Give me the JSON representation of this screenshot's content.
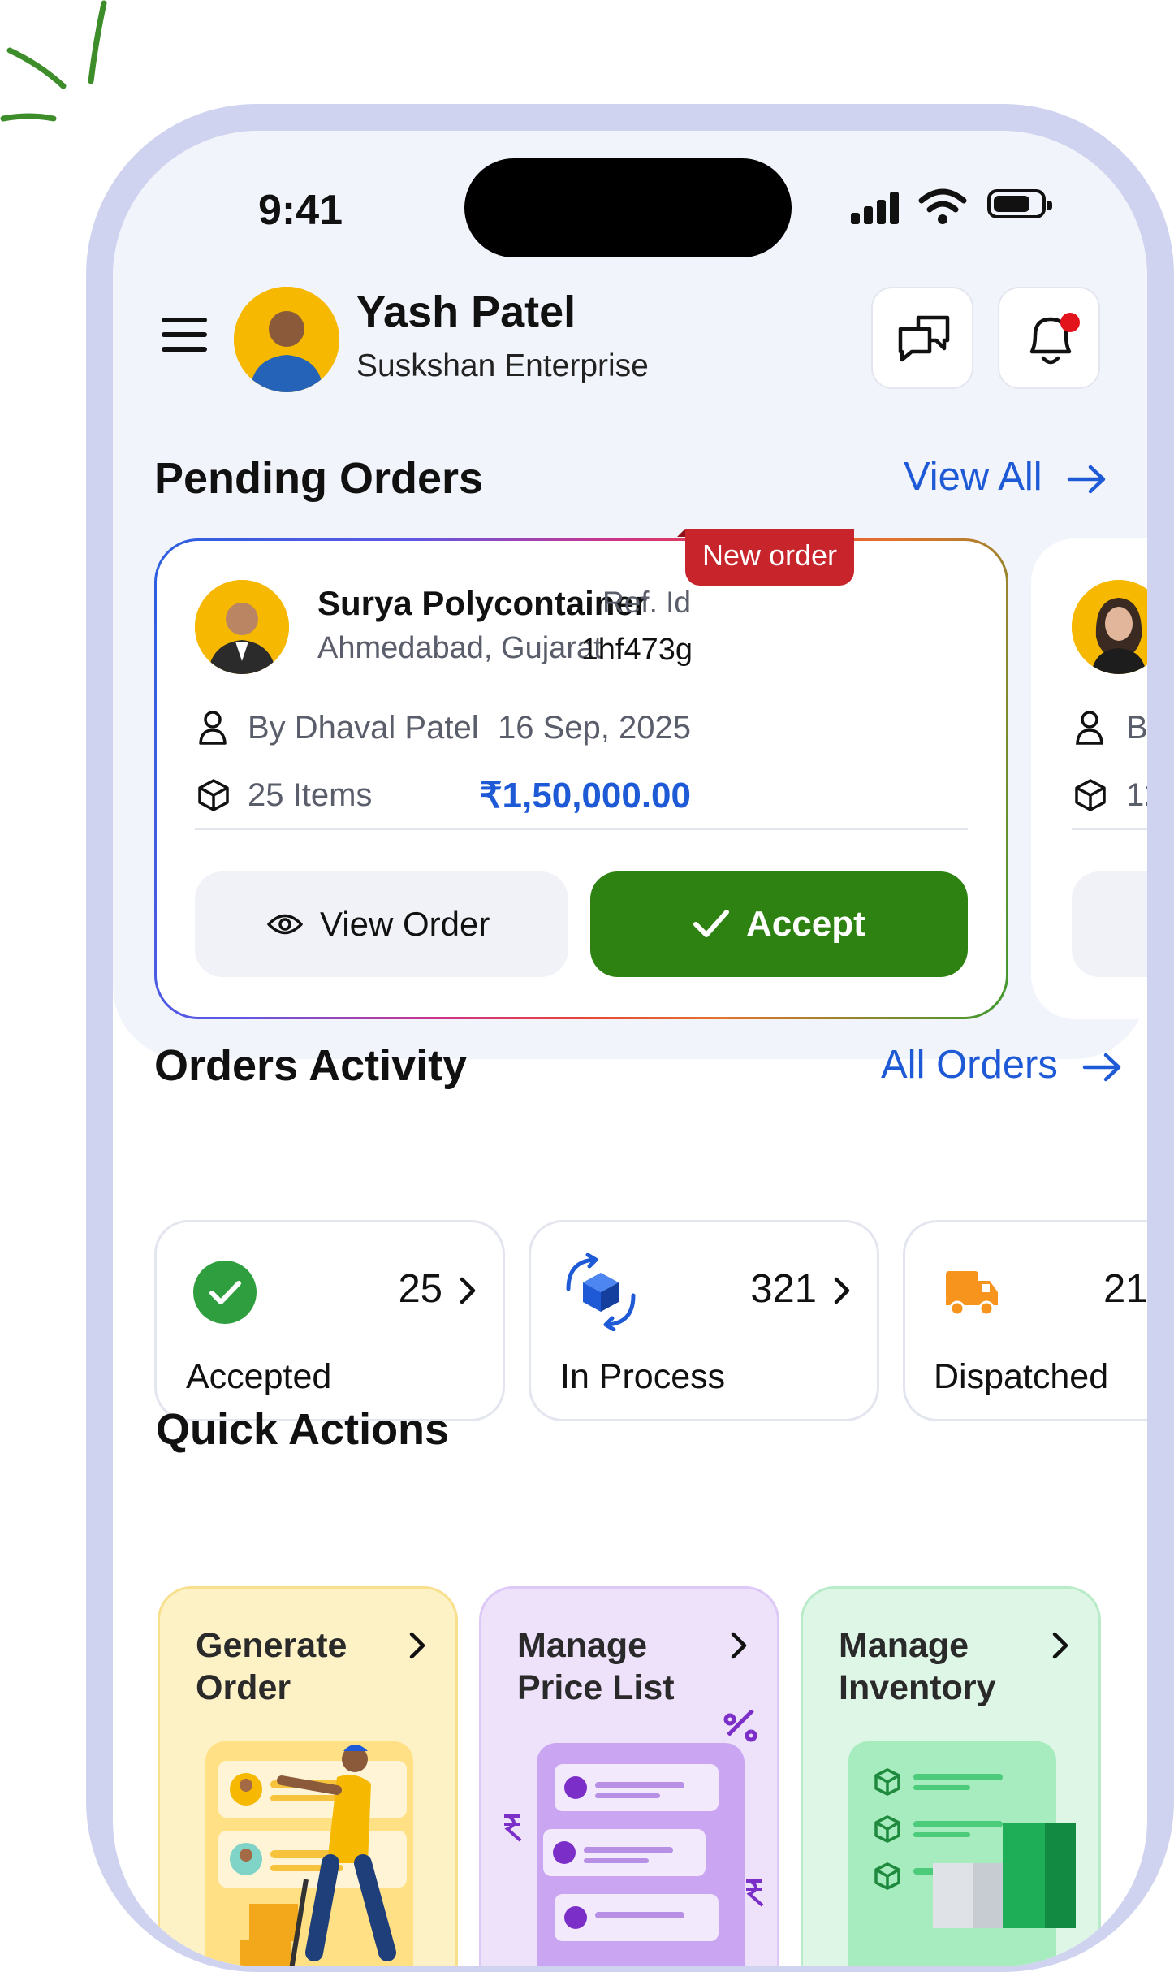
{
  "status_bar": {
    "time": "9:41"
  },
  "header": {
    "user_name": "Yash Patel",
    "company": "Suskshan Enterprise"
  },
  "pending_orders": {
    "title": "Pending Orders",
    "view_all": "View All",
    "card": {
      "badge": "New order",
      "customer": "Surya Polycontainer",
      "location": "Ahmedabad, Gujarat",
      "ref_label": "Ref. Id",
      "ref_id": "1hf473g",
      "by": "By Dhaval Patel",
      "date": "16 Sep, 2025",
      "items": "25 Items",
      "amount": "₹1,50,000.00",
      "view_order": "View Order",
      "accept": "Accept"
    },
    "next_card": {
      "by_partial": "B",
      "items_partial": "12"
    }
  },
  "orders_activity": {
    "title": "Orders Activity",
    "all_orders": "All Orders",
    "items": [
      {
        "label": "Accepted",
        "count": "25",
        "color": "#2e9e3e"
      },
      {
        "label": "In Process",
        "count": "321",
        "color": "#1f5ad6"
      },
      {
        "label": "Dispatched",
        "count": "21",
        "color": "#f7941d"
      }
    ]
  },
  "quick_actions": {
    "title": "Quick Actions",
    "items": [
      {
        "title": "Generate Order",
        "bg": "#fdf1c6",
        "border": "#f7df8c"
      },
      {
        "title": "Manage Price List",
        "bg": "#eee2fb",
        "border": "#ddc8f7"
      },
      {
        "title": "Manage Inventory",
        "bg": "#ddf6e6",
        "border": "#b8ecc9"
      }
    ]
  }
}
